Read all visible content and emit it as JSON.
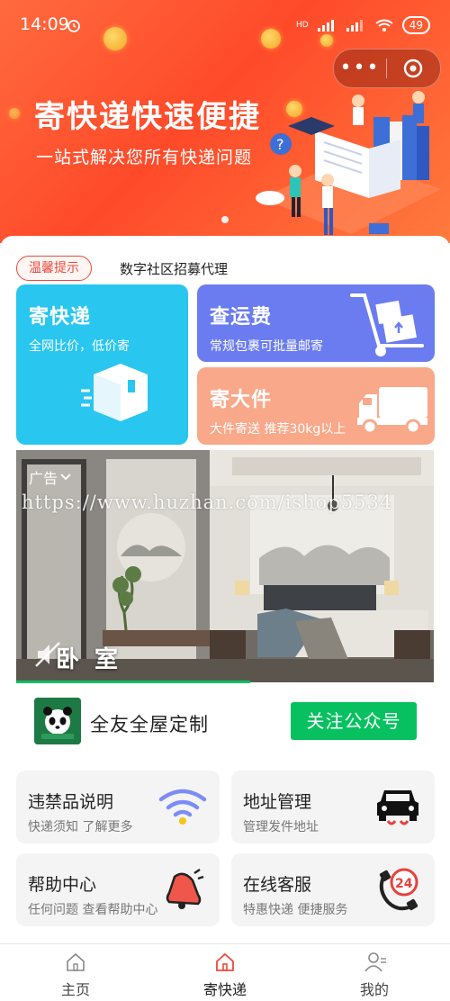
{
  "status_bar": {
    "time": "14:09",
    "network": "HD",
    "battery": "49"
  },
  "banner": {
    "title": "寄快递快速便捷",
    "subtitle": "一站式解决您所有快递问题"
  },
  "notice": {
    "tag": "温馨提示",
    "text": "数字社区招募代理"
  },
  "tiles": {
    "send": {
      "title": "寄快递",
      "subtitle": "全网比价，低价寄"
    },
    "freight": {
      "title": "查运费",
      "subtitle": "常规包裹可批量邮寄"
    },
    "large": {
      "title": "寄大件",
      "subtitle": "大件寄送 推荐30kg以上"
    }
  },
  "ad": {
    "label": "广告",
    "caption": "卧 室",
    "watermark": "https://www.huzhan.com/ishop5534",
    "progress": 0.56
  },
  "follow": {
    "brand": "全友全屋定制",
    "button": "关注公众号"
  },
  "services": [
    {
      "title": "违禁品说明",
      "subtitle": "快递须知 了解更多",
      "icon": "wifi-icon"
    },
    {
      "title": "地址管理",
      "subtitle": "管理发件地址",
      "icon": "car-icon"
    },
    {
      "title": "帮助中心",
      "subtitle": "任何问题 查看帮助中心",
      "icon": "bell-icon"
    },
    {
      "title": "在线客服",
      "subtitle": "特惠快递 便捷服务",
      "icon": "support-24-icon"
    }
  ],
  "tabbar": {
    "items": [
      {
        "label": "主页",
        "icon": "home-icon"
      },
      {
        "label": "寄快递",
        "icon": "home-active-icon"
      },
      {
        "label": "我的",
        "icon": "user-icon"
      }
    ],
    "active_color": "#e94b3c"
  },
  "colors": {
    "accent": "#e94b3c",
    "wechat_green": "#07c160",
    "tile_send": "#29c6f0",
    "tile_freight": "#6a7cf0",
    "tile_large": "#f9a88a"
  }
}
